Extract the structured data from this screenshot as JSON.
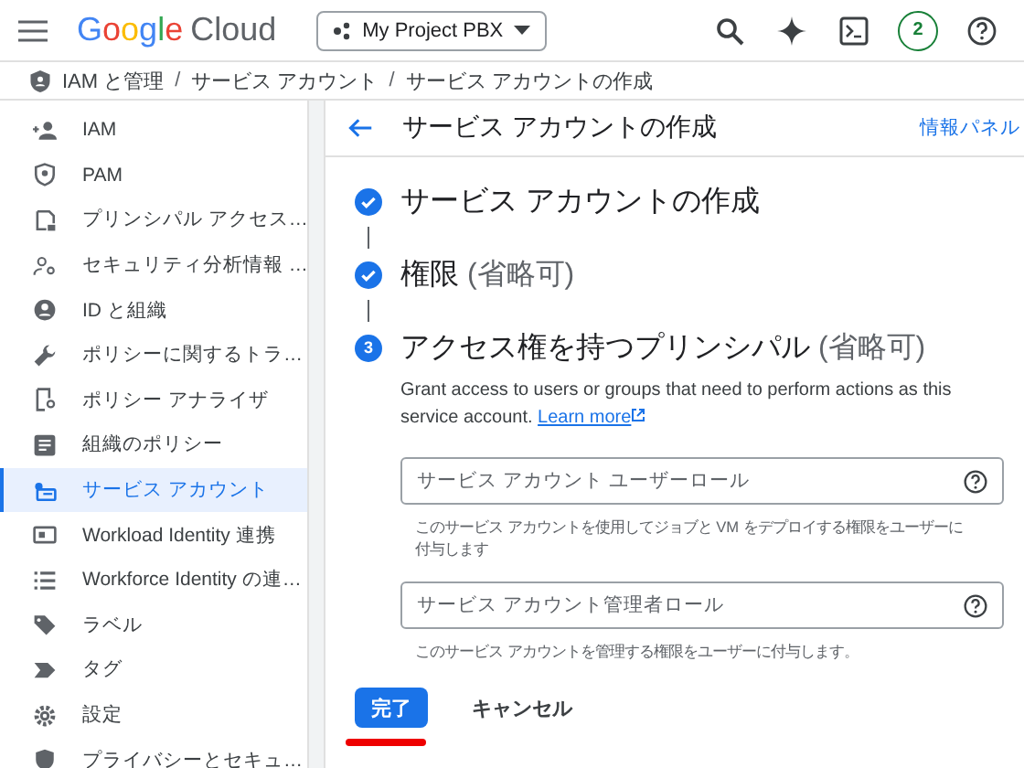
{
  "topbar": {
    "logo_google": "Google",
    "logo_cloud": "Cloud",
    "project": "My Project PBX",
    "notifications": "2"
  },
  "breadcrumb_separator": "/",
  "breadcrumb": [
    "IAM と管理",
    "サービス アカウント",
    "サービス アカウントの作成"
  ],
  "sidebar": {
    "items": [
      {
        "label": "IAM",
        "selected": false
      },
      {
        "label": "PAM",
        "selected": false
      },
      {
        "label": "プリンシパル アクセス…",
        "selected": false
      },
      {
        "label": "セキュリティ分析情報 …",
        "selected": false
      },
      {
        "label": "ID と組織",
        "selected": false
      },
      {
        "label": "ポリシーに関するトラ…",
        "selected": false
      },
      {
        "label": "ポリシー アナライザ",
        "selected": false
      },
      {
        "label": "組織のポリシー",
        "selected": false
      },
      {
        "label": "サービス アカウント",
        "selected": true
      },
      {
        "label": "Workload Identity 連携",
        "selected": false
      },
      {
        "label": "Workforce Identity の連…",
        "selected": false
      },
      {
        "label": "ラベル",
        "selected": false
      },
      {
        "label": "タグ",
        "selected": false
      },
      {
        "label": "設定",
        "selected": false
      },
      {
        "label": "プライバシーとセキュ…",
        "selected": false
      }
    ]
  },
  "page": {
    "title": "サービス アカウントの作成",
    "info_panel": "情報パネル"
  },
  "steps": [
    {
      "title": "サービス アカウントの作成",
      "completed": true
    },
    {
      "title": "権限",
      "optional": "(省略可)",
      "completed": true
    },
    {
      "title": "アクセス権を持つプリンシパル",
      "optional": "(省略可)",
      "completed": false,
      "number": "3"
    }
  ],
  "description": "Grant access to users or groups that need to perform actions as this service account.",
  "learn_more": "Learn more",
  "fields": [
    {
      "placeholder": "サービス アカウント ユーザーロール",
      "hint": "このサービス アカウントを使用してジョブと VM をデプロイする権限をユーザーに付与します"
    },
    {
      "placeholder": "サービス アカウント管理者ロール",
      "hint": "このサービス アカウントを管理する権限をユーザーに付与します。"
    }
  ],
  "buttons": {
    "done": "完了",
    "cancel": "キャンセル"
  }
}
